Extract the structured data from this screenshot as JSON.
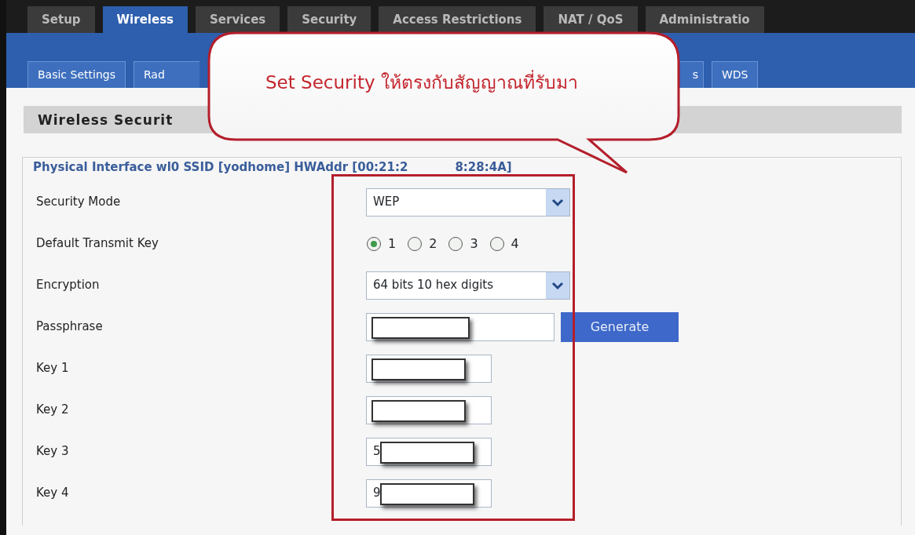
{
  "main_tabs": [
    {
      "label": "Setup",
      "selected": false
    },
    {
      "label": "Wireless",
      "selected": true
    },
    {
      "label": "Services",
      "selected": false
    },
    {
      "label": "Security",
      "selected": false
    },
    {
      "label": "Access Restrictions",
      "selected": false
    },
    {
      "label": "NAT / QoS",
      "selected": false
    },
    {
      "label": "Administratio",
      "selected": false
    }
  ],
  "sub_tabs": [
    {
      "label": "Basic Settings"
    },
    {
      "label": "Rad"
    },
    {
      "label": "s"
    },
    {
      "label": "WDS"
    }
  ],
  "section_title": "Wireless Securit",
  "fieldset": {
    "legend": [
      "Physical Interface wl0 SSID [yodhome] HWAddr [00:21:2",
      "8:28:4A]"
    ],
    "fields": [
      {
        "kind": "select",
        "label": "Security Mode",
        "value": "WEP"
      },
      {
        "kind": "radio",
        "label": "Default Transmit Key",
        "options": [
          {
            "label": "1",
            "selected": true
          },
          {
            "label": "2",
            "selected": false
          },
          {
            "label": "3",
            "selected": false
          },
          {
            "label": "4",
            "selected": false
          }
        ]
      },
      {
        "kind": "select",
        "label": "Encryption",
        "value": "64 bits 10 hex digits"
      },
      {
        "kind": "input",
        "label": "Passphrase",
        "wide": true,
        "redacted": true,
        "button": "Generate"
      },
      {
        "kind": "input",
        "label": "Key 1",
        "redacted": true
      },
      {
        "kind": "input",
        "label": "Key 2",
        "redacted": true
      },
      {
        "kind": "input",
        "label": "Key 3",
        "value": "5",
        "redacted": true
      },
      {
        "kind": "input",
        "label": "Key 4",
        "value": "9",
        "redacted": true
      }
    ]
  },
  "callout": {
    "text": "Set Security ให้ตรงกับสัญญาณที่รับมา"
  }
}
